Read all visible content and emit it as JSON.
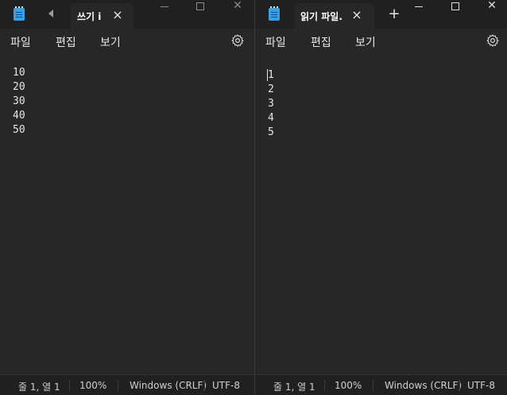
{
  "left_window": {
    "tab_title": "쓰기 i",
    "menu": [
      "파일",
      "편집",
      "보기"
    ],
    "lines": [
      "10",
      "20",
      "30",
      "40",
      "50"
    ],
    "status": {
      "position": "줄 1, 열 1",
      "zoom": "100%",
      "line_ending": "Windows (CRLF)",
      "encoding": "UTF-8"
    }
  },
  "right_window": {
    "tab_title": "읽기 파일.",
    "menu": [
      "파일",
      "편집",
      "보기"
    ],
    "lines": [
      "1",
      "2",
      "3",
      "4",
      "5"
    ],
    "status": {
      "position": "줄 1, 열 1",
      "zoom": "100%",
      "line_ending": "Windows (CRLF)",
      "encoding": "UTF-8"
    }
  },
  "icons": {
    "app": "notepad-icon",
    "tab_close": "×",
    "new_tab": "+",
    "window_close": "✕",
    "settings": "gear-icon"
  },
  "colors": {
    "app_icon": "#3aa0e6",
    "background": "#272727",
    "titlebar": "#202020"
  }
}
